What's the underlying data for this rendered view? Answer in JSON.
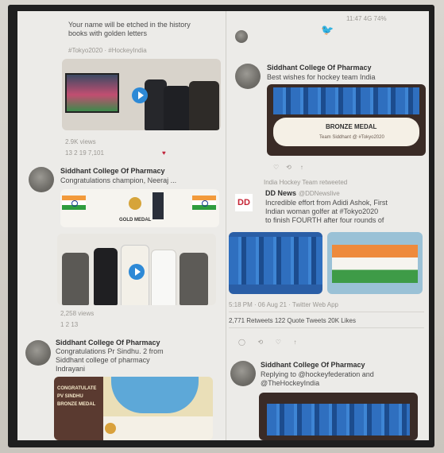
{
  "left_col": {
    "top_text_line1": "Your name will be etched in the history",
    "top_text_line2": "books with golden letters",
    "top_meta": "#Tokyo2020 · #HockeyIndia",
    "top_views": "2.9K views",
    "top_stats": "13     2    19   7,101",
    "tweet1": {
      "author": "Siddhant College Of Pharmacy",
      "text": "Congratulations champion, Neeraj ...",
      "poster_label": "GOLD MEDAL",
      "views": "2,258 views",
      "stats": "1     2     13"
    },
    "tweet2": {
      "author": "Siddhant College Of Pharmacy",
      "text_line1": "Congratulations Pr Sindhu. 2 from",
      "text_line2": "Siddhant college of pharmacy",
      "text_line3": "Indrayani",
      "poster_line1": "CONGRATULATE",
      "poster_line2": "PV SINDHU",
      "poster_line3": "BRONZE MEDAL"
    }
  },
  "right_col": {
    "status_bar": "11:47   4G   74%",
    "twitter_icon_name": "twitter-bird-icon",
    "tweet1": {
      "author": "Siddhant College Of Pharmacy",
      "text": "Best wishes for hockey team India",
      "banner_title": "BRONZE MEDAL",
      "banner_footer": "Team Siddhant @ #Tokyo2020"
    },
    "tweet2": {
      "retweet": "India Hockey Team retweeted",
      "author": "DD News",
      "handle": "@DDNewslive",
      "text_line1": "Incredible effort from Adidi Ashok, First",
      "text_line2": "Indian woman golfer at #Tokyo2020",
      "text_line3": "to finish FOURTH after four rounds of",
      "meta": "5:18 PM · 06 Aug 21 · Twitter Web App",
      "counts": "2,771 Retweets   122 Quote Tweets   20K Likes"
    },
    "tweet3": {
      "author": "Siddhant College Of Pharmacy",
      "text_line1": "Replying to @hockeyfederation and",
      "text_line2": "@TheHockeyIndia"
    }
  }
}
